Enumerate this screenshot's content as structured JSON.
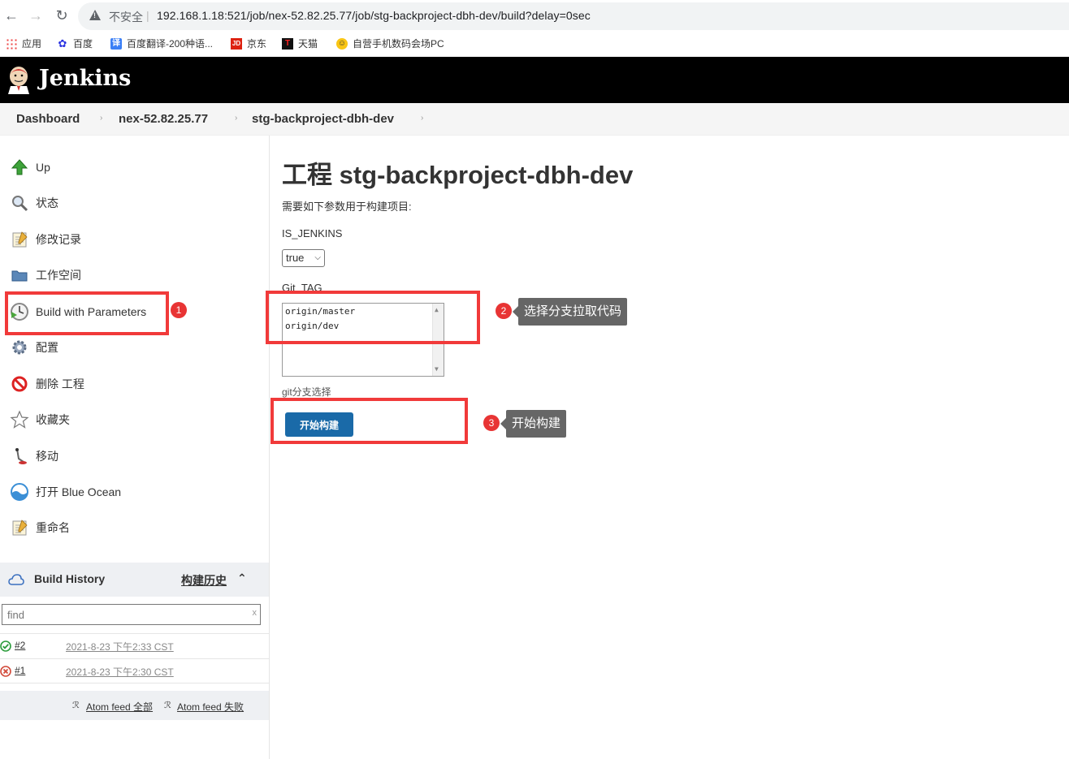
{
  "browser": {
    "insecure_label": "不安全",
    "url": "192.168.1.18:521/job/nex-52.82.25.77/job/stg-backproject-dbh-dev/build?delay=0sec",
    "bookmarks": [
      "应用",
      "百度",
      "百度翻译-200种语...",
      "京东",
      "天猫",
      "自营手机数码会场PC"
    ]
  },
  "header": {
    "app_name": "Jenkins"
  },
  "breadcrumb": [
    "Dashboard",
    "nex-52.82.25.77",
    "stg-backproject-dbh-dev"
  ],
  "sidebar": {
    "items": [
      {
        "label": "Up",
        "icon": "up-arrow-icon"
      },
      {
        "label": "状态",
        "icon": "magnifier-icon"
      },
      {
        "label": "修改记录",
        "icon": "notepad-icon"
      },
      {
        "label": "工作空间",
        "icon": "folder-icon"
      },
      {
        "label": "Build with Parameters",
        "icon": "clock-build-icon"
      },
      {
        "label": "配置",
        "icon": "gear-icon"
      },
      {
        "label": "删除 工程",
        "icon": "no-entry-icon"
      },
      {
        "label": "收藏夹",
        "icon": "star-icon"
      },
      {
        "label": "移动",
        "icon": "move-icon"
      },
      {
        "label": "打开 Blue Ocean",
        "icon": "blue-ocean-icon"
      },
      {
        "label": "重命名",
        "icon": "notepad-icon"
      }
    ]
  },
  "build_history": {
    "title": "Build History",
    "link": "构建历史",
    "search_placeholder": "find",
    "clear": "x",
    "builds": [
      {
        "number": "#2",
        "time": "2021-8-23 下午2:33 CST",
        "status": "success"
      },
      {
        "number": "#1",
        "time": "2021-8-23 下午2:30 CST",
        "status": "failed"
      }
    ],
    "feeds": [
      "Atom feed 全部",
      "Atom feed 失败"
    ]
  },
  "main": {
    "title": "工程 stg-backproject-dbh-dev",
    "description": "需要如下参数用于构建项目:",
    "params": [
      {
        "name": "IS_JENKINS",
        "value": "true"
      },
      {
        "name": "Git_TAG",
        "options": [
          "origin/master",
          "origin/dev"
        ],
        "help": "git分支选择"
      }
    ],
    "build_button": "开始构建"
  },
  "annotations": [
    {
      "number": "1",
      "text": ""
    },
    {
      "number": "2",
      "text": "选择分支拉取代码"
    },
    {
      "number": "3",
      "text": "开始构建"
    }
  ],
  "colors": {
    "accent": "#1a6aa8",
    "annotation": "#f13a3a",
    "header": "#000000"
  }
}
